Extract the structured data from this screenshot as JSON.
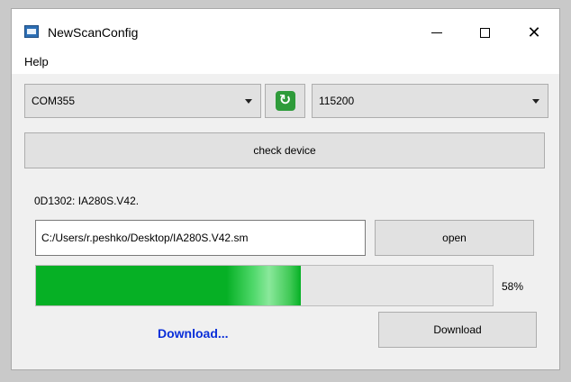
{
  "window": {
    "title": "NewScanConfig",
    "icon": "app-window-icon"
  },
  "menu": {
    "items": [
      "Help"
    ]
  },
  "port_select": {
    "value": "COM355"
  },
  "baud_select": {
    "value": "115200"
  },
  "refresh_icon": "refresh-icon",
  "check_button": {
    "label": "check device"
  },
  "device_info": "0D1302: IA280S.V42.",
  "file": {
    "path": "C:/Users/r.peshko/Desktop/IA280S.V42.sm",
    "open_label": "open"
  },
  "progress": {
    "value": 0.58,
    "label": "58%",
    "color": "#06b025"
  },
  "status": {
    "text": "Download...",
    "color": "#0a2fd9"
  },
  "download_button": {
    "label": "Download"
  }
}
